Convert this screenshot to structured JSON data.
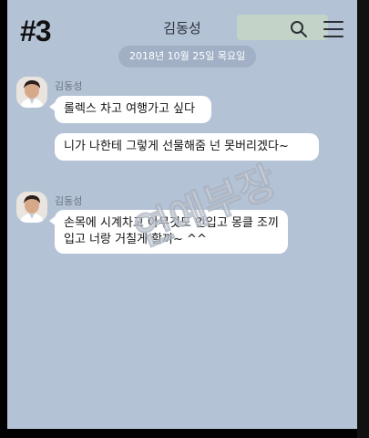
{
  "header": {
    "episode_tag": "#3",
    "chat_title": "김동성",
    "search_icon": "search-icon",
    "menu_icon": "menu-icon"
  },
  "date_divider": "2018년 10월 25일 목요일",
  "messages": [
    {
      "sender": "김동성",
      "bubbles": [
        "롤렉스 차고 여행가고 싶다",
        "니가 나한테 그렇게 선물해줌 넌 못버리겠다~"
      ]
    },
    {
      "sender": "김동성",
      "bubbles": [
        "손목에 시계차고 아무것도 안입고 몽클 조끼입고 너랑 거칠게 할까~ ^^"
      ]
    }
  ],
  "watermark_text": "연예부장",
  "colors": {
    "chat_background": "#b4c2d6",
    "bubble": "#ffffff",
    "date_pill": "#a1b0c5",
    "watermark": "#ffffff"
  }
}
